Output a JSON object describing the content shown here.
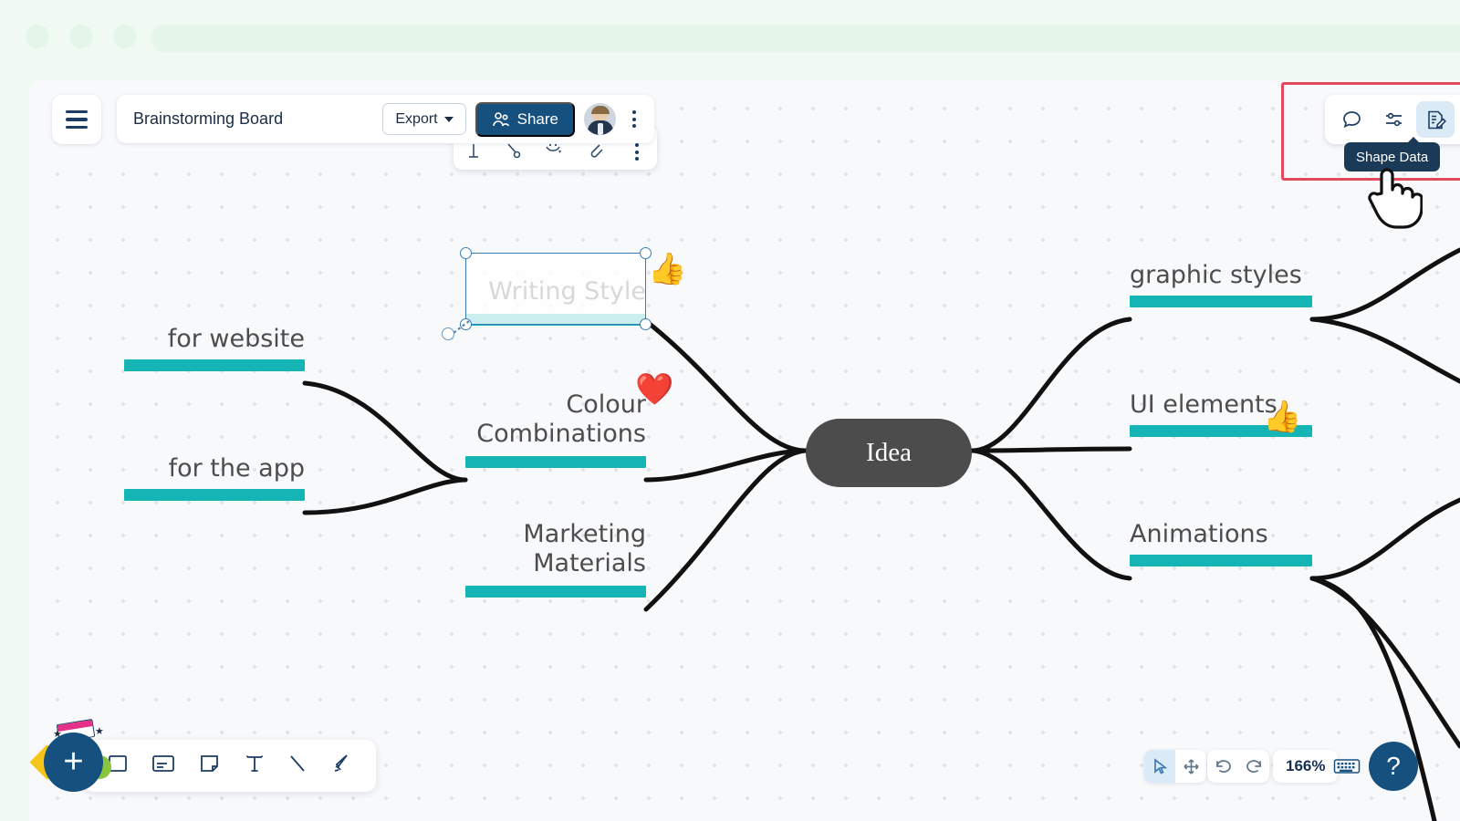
{
  "browser": {
    "dots": [
      "",
      "",
      ""
    ]
  },
  "header": {
    "menu_icon": "hamburger-icon",
    "board_title": "Brainstorming Board",
    "export_label": "Export",
    "share_label": "Share",
    "avatar_name": "user-avatar",
    "more_icon": "kebab-menu-icon"
  },
  "format_toolbar": {
    "icons": [
      "text-cursor-icon",
      "pin-icon",
      "emoji-icon",
      "attachment-icon",
      "more-icon"
    ]
  },
  "tool_panel": {
    "buttons": [
      {
        "name": "comments-icon",
        "label": "Comments",
        "active": false
      },
      {
        "name": "settings-sliders-icon",
        "label": "Settings",
        "active": false
      },
      {
        "name": "shape-data-icon",
        "label": "Shape Data",
        "active": true
      }
    ],
    "tooltip": "Shape Data",
    "highlight_color": "#e2495c"
  },
  "canvas": {
    "center_node": {
      "label": "Idea",
      "color": "#4c4c4c"
    },
    "accent_bar_color": "#16b5b5",
    "selected_node": "Writing Style",
    "nodes": [
      {
        "label": "Writing Style",
        "side": "left-upper",
        "emoji": "👍",
        "selected": true
      },
      {
        "label": "Colour\nCombinations",
        "side": "left-mid",
        "emoji": "❤️",
        "selected": false
      },
      {
        "label": "Marketing\nMaterials",
        "side": "left-lower",
        "emoji": "",
        "selected": false
      },
      {
        "label": "for website",
        "side": "far-left-upper",
        "emoji": "",
        "selected": false
      },
      {
        "label": "for the app",
        "side": "far-left-lower",
        "emoji": "",
        "selected": false
      },
      {
        "label": "graphic styles",
        "side": "right-upper",
        "emoji": "",
        "selected": false
      },
      {
        "label": "UI elements",
        "side": "right-mid",
        "emoji": "👍",
        "selected": false
      },
      {
        "label": "Animations",
        "side": "right-lower",
        "emoji": "",
        "selected": false
      }
    ]
  },
  "bottom_toolbar": {
    "add_label": "+",
    "tools": [
      {
        "name": "shape-square-tool",
        "label": "Shape"
      },
      {
        "name": "card-tool",
        "label": "Card"
      },
      {
        "name": "sticky-note-tool",
        "label": "Sticky note"
      },
      {
        "name": "text-tool",
        "label": "Text"
      },
      {
        "name": "line-tool",
        "label": "Line"
      },
      {
        "name": "pen-tool",
        "label": "Pen"
      }
    ]
  },
  "bottom_right": {
    "select_tool": "cursor-tool",
    "pan_tool": "pan-tool",
    "undo_label": "Undo",
    "redo_label": "Redo",
    "zoom_level": "166%",
    "keyboard_label": "Keyboard shortcuts",
    "help_label": "?"
  }
}
